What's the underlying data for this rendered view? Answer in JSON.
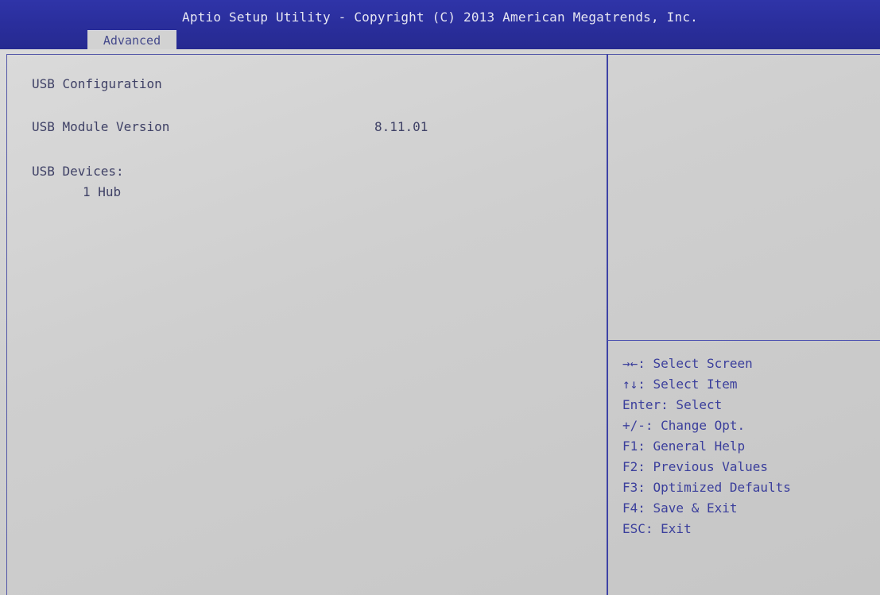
{
  "header": {
    "title": "Aptio Setup Utility - Copyright (C) 2013 American Megatrends, Inc.",
    "active_tab": "Advanced"
  },
  "main": {
    "heading": "USB Configuration",
    "module_version_label": "USB Module Version",
    "module_version_value": "8.11.01",
    "devices_label": "USB Devices:",
    "devices_value": "1 Hub"
  },
  "help": {
    "keys": [
      "→←: Select Screen",
      "↑↓: Select Item",
      "Enter: Select",
      "+/-: Change Opt.",
      "F1: General Help",
      "F2: Previous Values",
      "F3: Optimized Defaults",
      "F4: Save & Exit",
      "ESC: Exit"
    ]
  },
  "colors": {
    "header_bg": "#2a2e9c",
    "panel_bg": "#cfcfcf",
    "text": "#3f4166",
    "help_text": "#3b3f9c"
  }
}
